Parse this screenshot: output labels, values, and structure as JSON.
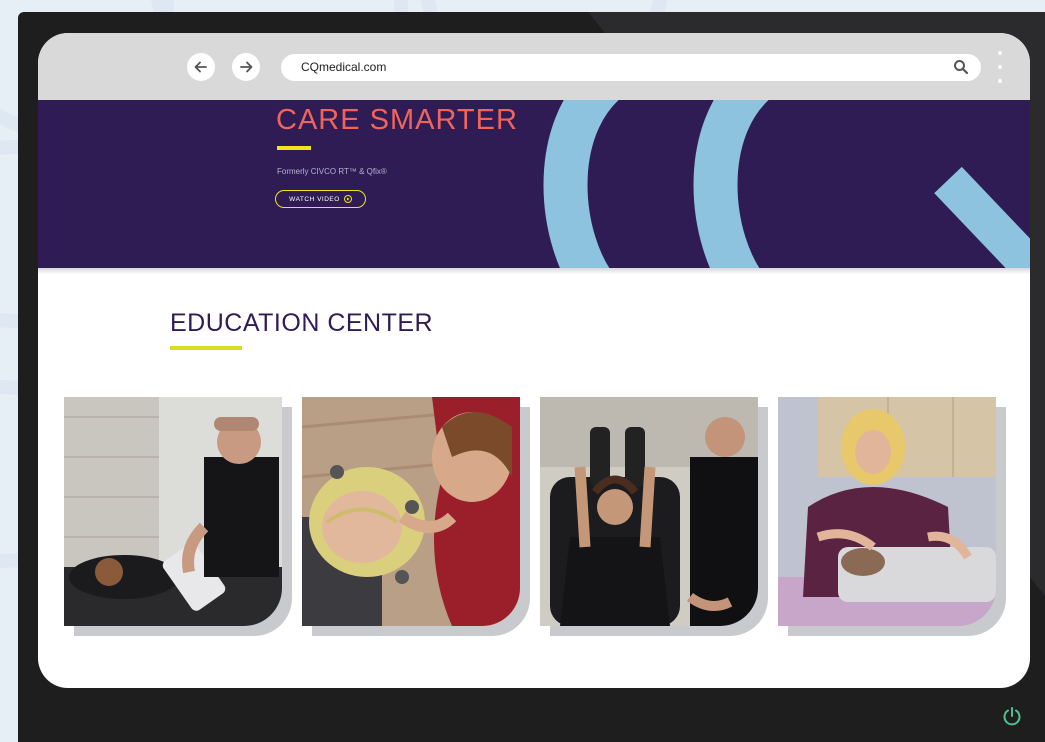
{
  "browser": {
    "url": "CQmedical.com",
    "back_icon": "arrow-left-icon",
    "forward_icon": "arrow-right-icon",
    "search_icon": "search-icon",
    "menu_icon": "kebab-menu-icon"
  },
  "hero": {
    "title": "CARE SMARTER",
    "subtitle": "Formerly CIVCO RT™ & Qfix®",
    "watch_button": "WATCH VIDEO",
    "colors": {
      "background": "#2f1c55",
      "title": "#f0645b",
      "accent": "#f1e31e",
      "art": "#8ec3df"
    }
  },
  "education": {
    "title": "EDUCATION CENTER",
    "accent_color": "#d8dd22"
  },
  "cards": [
    {
      "name": "Patient positioning with arm support device"
    },
    {
      "name": "Head mask fitting on patient"
    },
    {
      "name": "Patient on positioning board with arms raised"
    },
    {
      "name": "Patient in prone position with body support"
    }
  ],
  "device": {
    "power_icon": "power-icon"
  }
}
